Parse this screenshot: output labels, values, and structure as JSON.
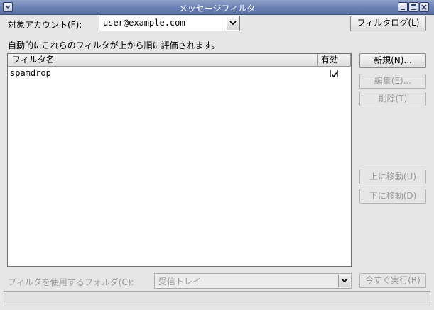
{
  "window": {
    "title": "メッセージフィルタ"
  },
  "account": {
    "label": "対象アカウント(F):",
    "value": "user@example.com",
    "filter_log_button": "フィルタログ(L)"
  },
  "description": "自動的にこれらのフィルタが上から順に評価されます。",
  "list": {
    "columns": [
      "フィルタ名",
      "有効"
    ],
    "rows": [
      {
        "name": "spamdrop",
        "enabled": true
      }
    ]
  },
  "buttons": {
    "new": "新規(N)...",
    "edit": "編集(E)...",
    "delete": "削除(T)",
    "move_up": "上に移動(U)",
    "move_down": "下に移動(D)",
    "run_now": "今すぐ実行(R)"
  },
  "folder": {
    "label": "フィルタを使用するフォルダ(C):",
    "value": "受信トレイ"
  }
}
